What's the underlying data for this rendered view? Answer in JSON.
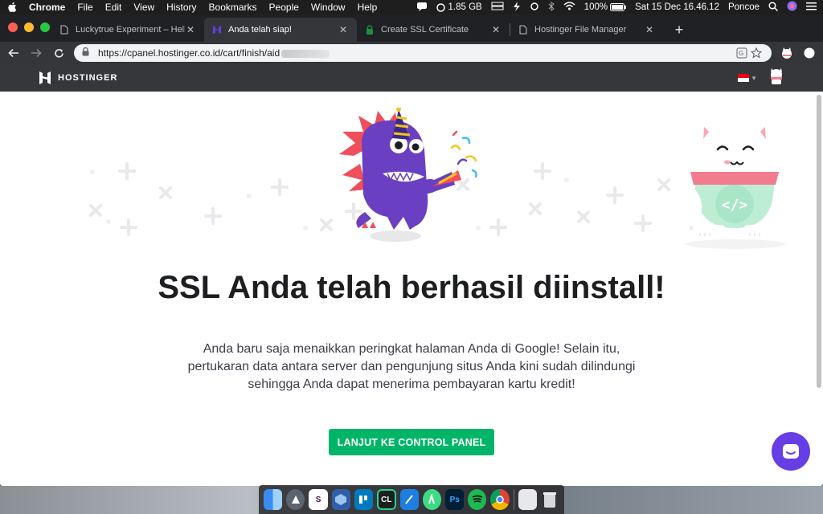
{
  "menubar": {
    "app": "Chrome",
    "items": [
      "File",
      "Edit",
      "View",
      "History",
      "Bookmarks",
      "People",
      "Window",
      "Help"
    ],
    "memory": "1.85 GB",
    "battery": "100%",
    "datetime": "Sat 15 Dec  16.46.12",
    "user": "Poncoe"
  },
  "tabs": [
    {
      "title": "Luckytrue Experiment – Hello W",
      "active": false
    },
    {
      "title": "Anda telah siap!",
      "active": true
    },
    {
      "title": "Create SSL Certificate",
      "active": false
    },
    {
      "title": "Hostinger File Manager",
      "active": false
    }
  ],
  "toolbar": {
    "url": "https://cpanel.hostinger.co.id/cart/finish/aid"
  },
  "site": {
    "brand": "HOSTINGER"
  },
  "content": {
    "headline": "SSL Anda telah berhasil diinstall!",
    "description": "Anda baru saja menaikkan peringkat halaman Anda di Google! Selain itu, pertukaran data antara server dan pengunjung situs Anda kini sudah dilindungi sehingga Anda dapat menerima pembayaran kartu kredit!",
    "cta_label": "LANJUT KE CONTROL PANEL",
    "cat_code": "</>"
  },
  "colors": {
    "accent_green": "#00b568",
    "chat_purple": "#673de6",
    "dino_purple": "#6a3fc1"
  },
  "dock": {
    "slack_letter": "S",
    "clion_label": "CL",
    "photoshop_label": "Ps"
  }
}
